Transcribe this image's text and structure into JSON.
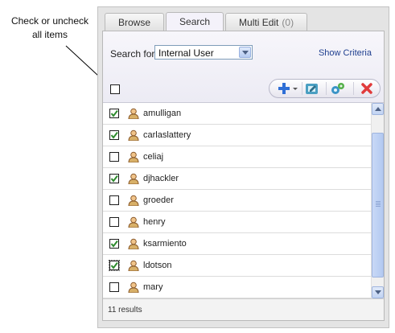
{
  "callout": {
    "line1": "Check or uncheck",
    "line2": "all items"
  },
  "tabs": [
    {
      "label": "Browse",
      "active": false
    },
    {
      "label": "Search",
      "active": true
    },
    {
      "label": "Multi Edit",
      "count": "(0)",
      "active": false
    }
  ],
  "criteria": {
    "search_label": "Search for",
    "search_value": "Internal User",
    "show_criteria": "Show Criteria"
  },
  "toolbar": {
    "add_icon": "add-icon",
    "edit_icon": "edit-icon",
    "bulk_icon": "gears-icon",
    "delete_icon": "delete-icon"
  },
  "users": [
    {
      "name": "amulligan",
      "checked": true
    },
    {
      "name": "carlaslattery",
      "checked": true
    },
    {
      "name": "celiaj",
      "checked": false
    },
    {
      "name": "djhackler",
      "checked": true
    },
    {
      "name": "groeder",
      "checked": false
    },
    {
      "name": "henry",
      "checked": false
    },
    {
      "name": "ksarmiento",
      "checked": true
    },
    {
      "name": "ldotson",
      "checked": true,
      "focused": true
    },
    {
      "name": "mary",
      "checked": false
    }
  ],
  "footer": {
    "results": "11 results"
  },
  "colors": {
    "check": "#2e8b2e",
    "delete": "#e03b3b",
    "add": "#2f6fd6",
    "link": "#1f3f8f"
  }
}
